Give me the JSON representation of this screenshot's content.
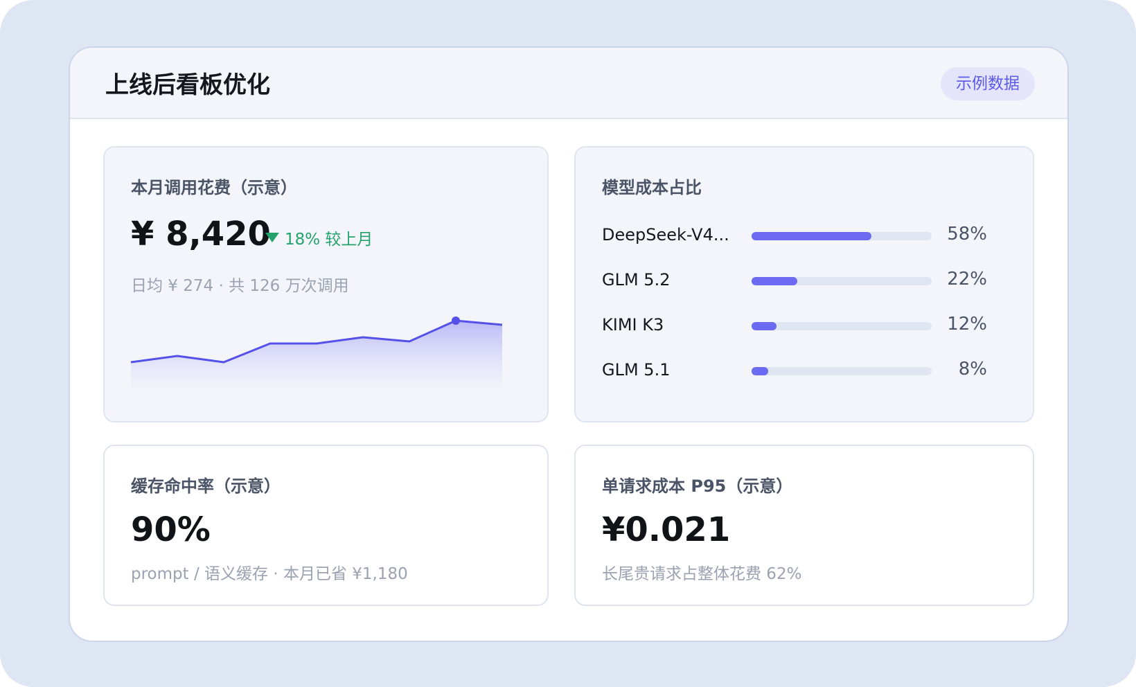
{
  "header": {
    "title": "上线后看板优化",
    "badge": "示例数据"
  },
  "spend": {
    "label": "本月调用花费（示意）",
    "value": "¥ 8,420",
    "change": "18% 较上月",
    "sub": "日均 ¥ 274 · 共 126 万次调用",
    "trend": [
      40,
      43,
      40,
      49,
      49,
      52,
      50,
      60,
      58
    ],
    "colors": {
      "line": "#5551e8",
      "change": "#23a36b"
    }
  },
  "share": {
    "label": "模型成本占比",
    "items": [
      {
        "name": "DeepSeek-V4...",
        "pct_text": "58%",
        "pct": 0.58
      },
      {
        "name": "GLM 5.2",
        "pct_text": "22%",
        "pct": 0.22
      },
      {
        "name": "KIMI K3",
        "pct_text": "12%",
        "pct": 0.12
      },
      {
        "name": "GLM 5.1",
        "pct_text": "8%",
        "pct": 0.08
      }
    ],
    "bar_color": "#6b6af0"
  },
  "cache": {
    "label": "缓存命中率（示意）",
    "value": "90%",
    "sub": "prompt / 语义缓存 · 本月已省 ¥1,180"
  },
  "p95": {
    "label": "单请求成本 P95（示意）",
    "value": "¥0.021",
    "sub": "长尾贵请求占整体花费 62%"
  }
}
